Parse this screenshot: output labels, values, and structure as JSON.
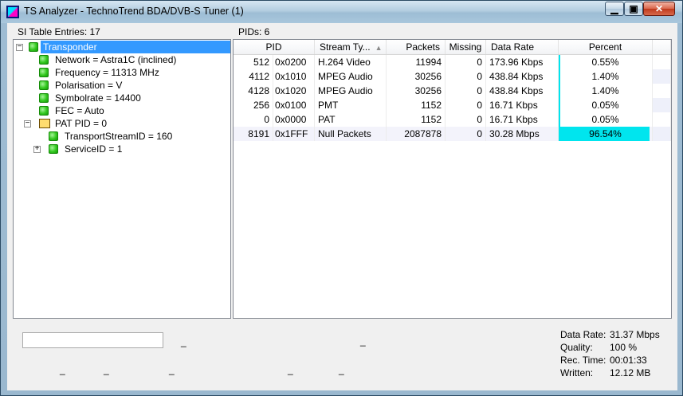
{
  "window": {
    "title": "TS Analyzer - TechnoTrend BDA/DVB-S Tuner (1)",
    "minimize_glyph": "▁",
    "restore_glyph": "▣",
    "close_glyph": "✕"
  },
  "left_panel": {
    "header": "SI Table Entries: 17",
    "tree": [
      {
        "label": "Transponder",
        "level": 0,
        "expander": "−",
        "icon": "green-node-icon",
        "selected": true
      },
      {
        "label": "Network = Astra1C (inclined)",
        "level": 1,
        "icon": "green-node-icon"
      },
      {
        "label": "Frequency = 11313 MHz",
        "level": 1,
        "icon": "green-node-icon"
      },
      {
        "label": "Polarisation = V",
        "level": 1,
        "icon": "green-node-icon"
      },
      {
        "label": "Symbolrate = 14400",
        "level": 1,
        "icon": "green-node-icon"
      },
      {
        "label": "FEC = Auto",
        "level": 1,
        "icon": "green-node-icon"
      },
      {
        "label": "PAT PID = 0",
        "level": 1,
        "expander": "−",
        "icon": "book-icon"
      },
      {
        "label": "TransportStreamID = 160",
        "level": 2,
        "icon": "green-node-icon"
      },
      {
        "label": "ServiceID = 1",
        "level": 2,
        "expander": "+",
        "icon": "green-node-icon"
      }
    ],
    "bottom": {
      "input_value": "",
      "dash_1": "_",
      "dash_2": "_",
      "dash_3": "_",
      "dash_4": "_"
    }
  },
  "right_panel": {
    "header": "PIDs: 6",
    "columns": [
      "PID",
      "Stream Ty...",
      "Packets",
      "Missing",
      "Data Rate",
      "Percent"
    ],
    "sort_indicator": "▲",
    "rows": [
      {
        "pid_dec": "512",
        "pid_hex": "0x0200",
        "stream_type": "H.264 Video",
        "packets": "11994",
        "missing": "0",
        "data_rate": "173.96 Kbps",
        "percent": "0.55%",
        "percent_value": 0.55
      },
      {
        "pid_dec": "4112",
        "pid_hex": "0x1010",
        "stream_type": "MPEG Audio",
        "packets": "30256",
        "missing": "0",
        "data_rate": "438.84 Kbps",
        "percent": "1.40%",
        "percent_value": 1.4
      },
      {
        "pid_dec": "4128",
        "pid_hex": "0x1020",
        "stream_type": "MPEG Audio",
        "packets": "30256",
        "missing": "0",
        "data_rate": "438.84 Kbps",
        "percent": "1.40%",
        "percent_value": 1.4
      },
      {
        "pid_dec": "256",
        "pid_hex": "0x0100",
        "stream_type": "PMT",
        "packets": "1152",
        "missing": "0",
        "data_rate": "16.71 Kbps",
        "percent": "0.05%",
        "percent_value": 0.05
      },
      {
        "pid_dec": "0",
        "pid_hex": "0x0000",
        "stream_type": "PAT",
        "packets": "1152",
        "missing": "0",
        "data_rate": "16.71 Kbps",
        "percent": "0.05%",
        "percent_value": 0.05
      },
      {
        "pid_dec": "8191",
        "pid_hex": "0x1FFF",
        "stream_type": "Null Packets",
        "packets": "2087878",
        "missing": "0",
        "data_rate": "30.28 Mbps",
        "percent": "96.54%",
        "percent_value": 96.54
      }
    ],
    "stats": [
      {
        "label": "Data Rate:",
        "value": "31.37 Mbps"
      },
      {
        "label": "Quality:",
        "value": "100 %"
      },
      {
        "label": "Rec. Time:",
        "value": "00:01:33"
      },
      {
        "label": "Written:",
        "value": "12.12 MB"
      }
    ],
    "bottom": {
      "dash_1": "_",
      "dash_2": "_",
      "dash_3": "_"
    }
  },
  "colors": {
    "bar": "#00e5ee",
    "selection": "#3399ff"
  }
}
